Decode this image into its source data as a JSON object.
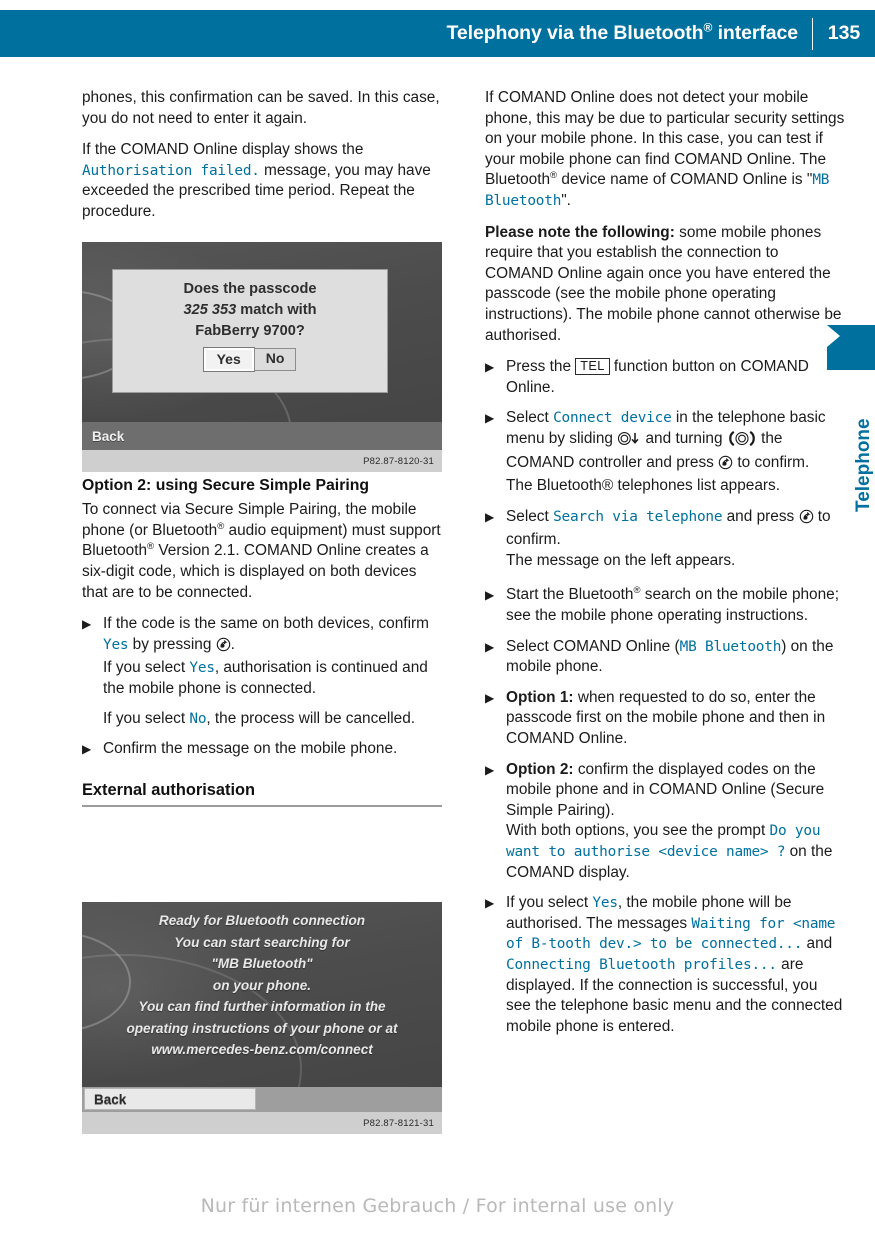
{
  "header": {
    "title_before": "Telephony via the Bluetooth",
    "title_sup": "®",
    "title_after": " interface",
    "page_number": "135",
    "bg_color": "#00709E"
  },
  "side_tab": {
    "label": "Telephone",
    "color": "#00709E"
  },
  "left_column": {
    "para_1": "phones, this confirmation can be saved. In this case, you do not need to enter it again.",
    "para_2_a": "If the COMAND Online display shows the ",
    "para_2_code": "Authorisation failed.",
    "para_2_b": " message, you may have exceeded the prescribed time period. Repeat the procedure.",
    "figure_1": {
      "dialog_line_1": "Does the passcode",
      "dialog_line_2_code": "325 353",
      "dialog_line_2_rest": " match with",
      "dialog_line_3": "FabBerry 9700?",
      "button_yes": "Yes",
      "button_no": "No",
      "back_label": "Back",
      "caption_code": "P82.87-8120-31"
    },
    "heading_option2": "Option 2: using Secure Simple Pairing",
    "para_3_a": "To connect via Secure Simple Pairing, the mobile phone (or Bluetooth",
    "para_3_b": " audio equipment) must support Bluetooth",
    "para_3_c": " Version 2.1. COMAND Online creates a six-digit code, which is displayed on both devices that are to be connected.",
    "steps": [
      {
        "marker": "▶",
        "main_a": "If the code is the same on both devices, confirm ",
        "main_code": "Yes",
        "main_b": " by pressing ",
        "main_icon": "comand-press-icon",
        "main_c": ".",
        "sub_1_a": "If you select ",
        "sub_1_code": "Yes",
        "sub_1_b": ", authorisation is continued and the mobile phone is connected.",
        "sub_2_a": "If you select ",
        "sub_2_code": "No",
        "sub_2_b": ", the process will be cancelled."
      },
      {
        "marker": "▶",
        "main_a": "Confirm the message on the mobile phone."
      }
    ],
    "heading_external": "External authorisation",
    "figure_2": {
      "lines": [
        "Ready for Bluetooth connection",
        "You can start searching for",
        "\"MB Bluetooth\"",
        "on your phone.",
        "You can find further information in the",
        "operating instructions of your phone or at",
        "www.mercedes-benz.com/connect"
      ],
      "back_label": "Back",
      "caption_code": "P82.87-8121-31"
    }
  },
  "right_column": {
    "para_1_a": "If COMAND Online does not detect your mobile phone, this may be due to particular security settings on your mobile phone. In this case, you can test if your mobile phone can find COMAND Online. The Bluetooth",
    "para_1_b": " device name of COMAND Online is \"",
    "para_1_code": "MB Bluetooth",
    "para_1_c": "\".",
    "para_2_bold": "Please note the following:",
    "para_2_rest": " some mobile phones require that you establish the connection to COMAND Online again once you have entered the passcode (see the mobile phone operating instructions). The mobile phone cannot otherwise be authorised.",
    "steps": [
      {
        "marker": "▶",
        "text_a": "Press the ",
        "keycap": "TEL",
        "text_b": " function button on COMAND Online."
      },
      {
        "marker": "▶",
        "text_a": "Select ",
        "code_1": "Connect device",
        "text_b": " in the telephone basic menu by sliding ",
        "icon_1": "comand-slide-down-icon",
        "text_c": " and turning ",
        "icon_2": "comand-turn-icon",
        "text_d": " the COMAND controller and press ",
        "icon_3": "comand-press-icon",
        "text_e": " to confirm.",
        "sub": "The Bluetooth® telephones list appears."
      },
      {
        "marker": "▶",
        "text_a": "Select ",
        "code_1": "Search via telephone",
        "text_b": " and press ",
        "icon_1": "comand-press-icon",
        "text_c": " to confirm.",
        "sub": "The message on the left appears."
      },
      {
        "marker": "▶",
        "text_a": "Start the Bluetooth",
        "text_b": " search on the mobile phone; see the mobile phone operating instructions."
      },
      {
        "marker": "▶",
        "text_a": "Select COMAND Online (",
        "code_1": "MB Bluetooth",
        "text_b": ") on the mobile phone."
      },
      {
        "marker": "▶",
        "bold": "Option 1:",
        "text_a": " when requested to do so, enter the passcode first on the mobile phone and then in COMAND Online."
      },
      {
        "marker": "▶",
        "bold": "Option 2:",
        "text_a": " confirm the displayed codes on the mobile phone and in COMAND Online (Secure Simple Pairing).",
        "sub_a": "With both options, you see the prompt ",
        "sub_code": "Do you want to authorise <device name> ?",
        "sub_b": " on the COMAND display."
      },
      {
        "marker": "▶",
        "text_a": "If you select ",
        "code_1": "Yes",
        "text_b": ", the mobile phone will be authorised. The messages ",
        "code_2": "Waiting for <name of B-tooth dev.> to be connected...",
        "text_c": " and ",
        "code_3": "Connecting Bluetooth profiles...",
        "text_d": " are displayed. If the connection is successful, you see the telephone basic menu and the connected mobile phone is entered."
      }
    ]
  },
  "footer": {
    "watermark": "Nur für internen Gebrauch / For internal use only"
  }
}
